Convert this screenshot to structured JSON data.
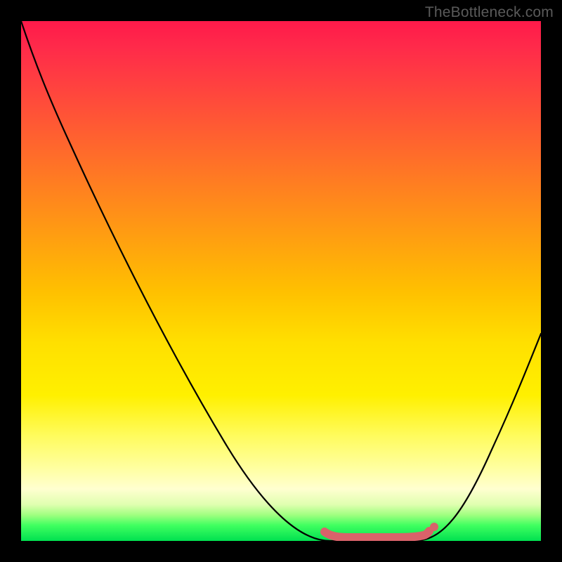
{
  "watermark": "TheBottleneck.com",
  "colors": {
    "gradient_top": "#ff1a4a",
    "gradient_mid": "#ffe000",
    "gradient_bottom": "#00e050",
    "curve": "#000000",
    "marker": "#d9626a",
    "background": "#000000"
  },
  "chart_data": {
    "type": "line",
    "title": "",
    "xlabel": "",
    "ylabel": "",
    "xlim": [
      0,
      100
    ],
    "ylim": [
      0,
      100
    ],
    "series": [
      {
        "name": "bottleneck-curve",
        "x": [
          0,
          5,
          10,
          15,
          20,
          25,
          30,
          35,
          40,
          45,
          50,
          55,
          60,
          63,
          68,
          73,
          76,
          80,
          85,
          90,
          95,
          100
        ],
        "values": [
          100,
          92,
          84,
          76,
          67,
          58,
          49,
          40,
          31,
          22,
          13,
          6,
          1,
          0,
          0,
          0,
          0,
          1,
          7,
          18,
          30,
          40
        ]
      }
    ],
    "annotations": [
      {
        "name": "optimal-range",
        "x_start": 58,
        "x_end": 80,
        "color": "#d9626a"
      }
    ],
    "background_gradient": {
      "orientation": "vertical",
      "stops": [
        {
          "pos": 0.0,
          "color": "#ff1a4a"
        },
        {
          "pos": 0.5,
          "color": "#ffc000"
        },
        {
          "pos": 0.85,
          "color": "#ffffb0"
        },
        {
          "pos": 1.0,
          "color": "#00e050"
        }
      ]
    }
  }
}
